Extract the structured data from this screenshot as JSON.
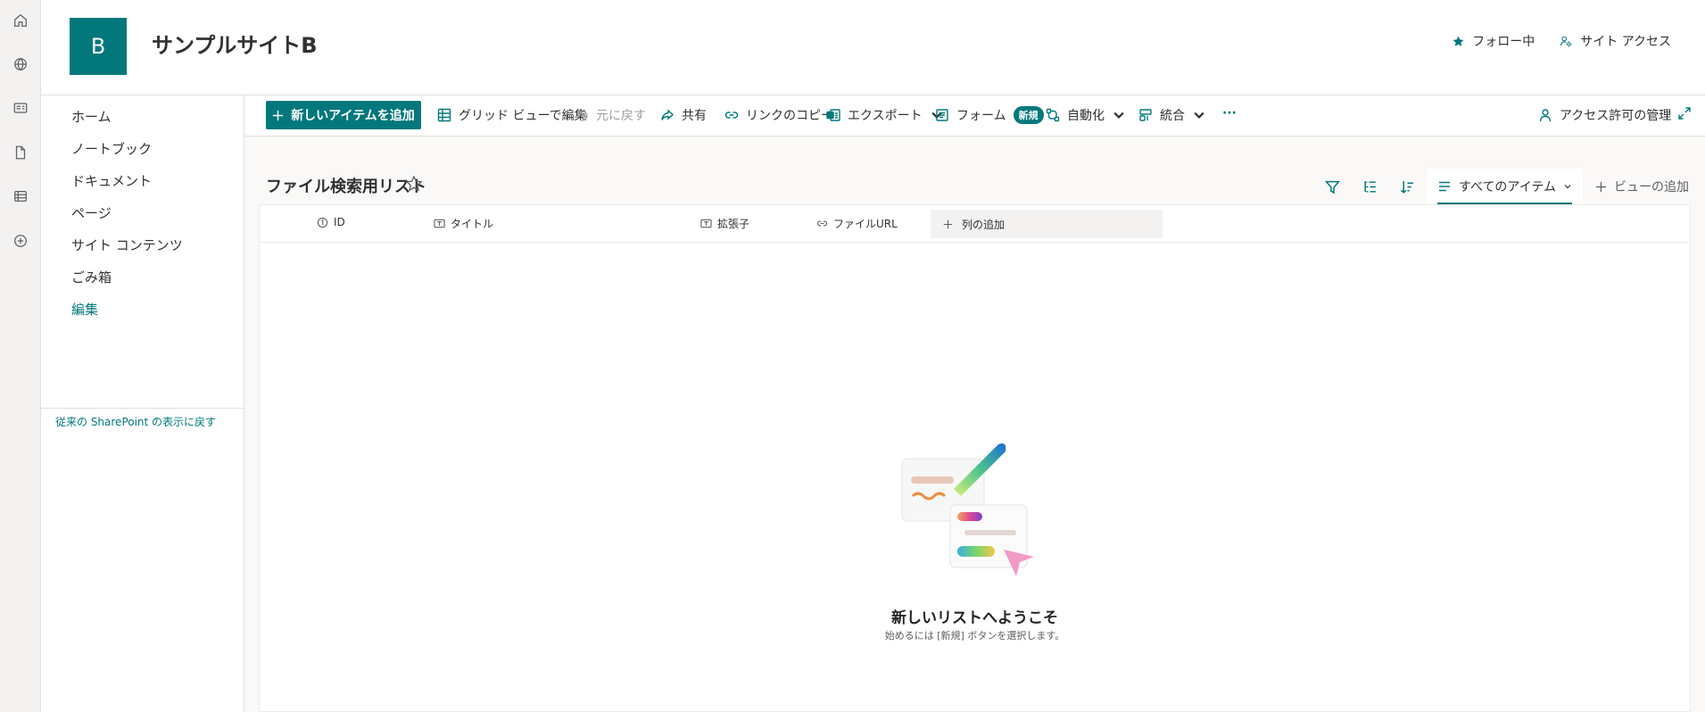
{
  "site": {
    "logo_letter": "B",
    "title": "サンプルサイトB"
  },
  "header": {
    "follow_label": "フォロー中",
    "site_access_label": "サイト アクセス"
  },
  "app_rail": {
    "icons": [
      "home-icon",
      "globe-icon",
      "news-icon",
      "document-icon",
      "list-icon",
      "add-icon"
    ]
  },
  "nav": {
    "items": [
      "ホーム",
      "ノートブック",
      "ドキュメント",
      "ページ",
      "サイト コンテンツ",
      "ごみ箱"
    ],
    "edit_label": "編集",
    "return_classic": "従来の SharePoint の表示に戻す"
  },
  "commandbar": {
    "new_item": "新しいアイテムを追加",
    "grid_edit": "グリッド ビューで編集",
    "undo": "元に戻す",
    "share": "共有",
    "copy_link": "リンクのコピー",
    "export": "エクスポート",
    "forms": "フォーム",
    "new_badge": "新規",
    "automate": "自動化",
    "integrate": "統合",
    "more": "···",
    "manage_access": "アクセス許可の管理"
  },
  "list": {
    "title": "ファイル検索用リスト",
    "current_view": "すべてのアイテム",
    "add_view": "ビューの追加",
    "columns": [
      "ID",
      "タイトル",
      "拡張子",
      "ファイルURL"
    ],
    "add_column": "列の追加",
    "empty_title": "新しいリストへようこそ",
    "empty_subtitle": "始めるには [新規] ボタンを選択します。"
  },
  "colors": {
    "accent": "#03787c"
  }
}
